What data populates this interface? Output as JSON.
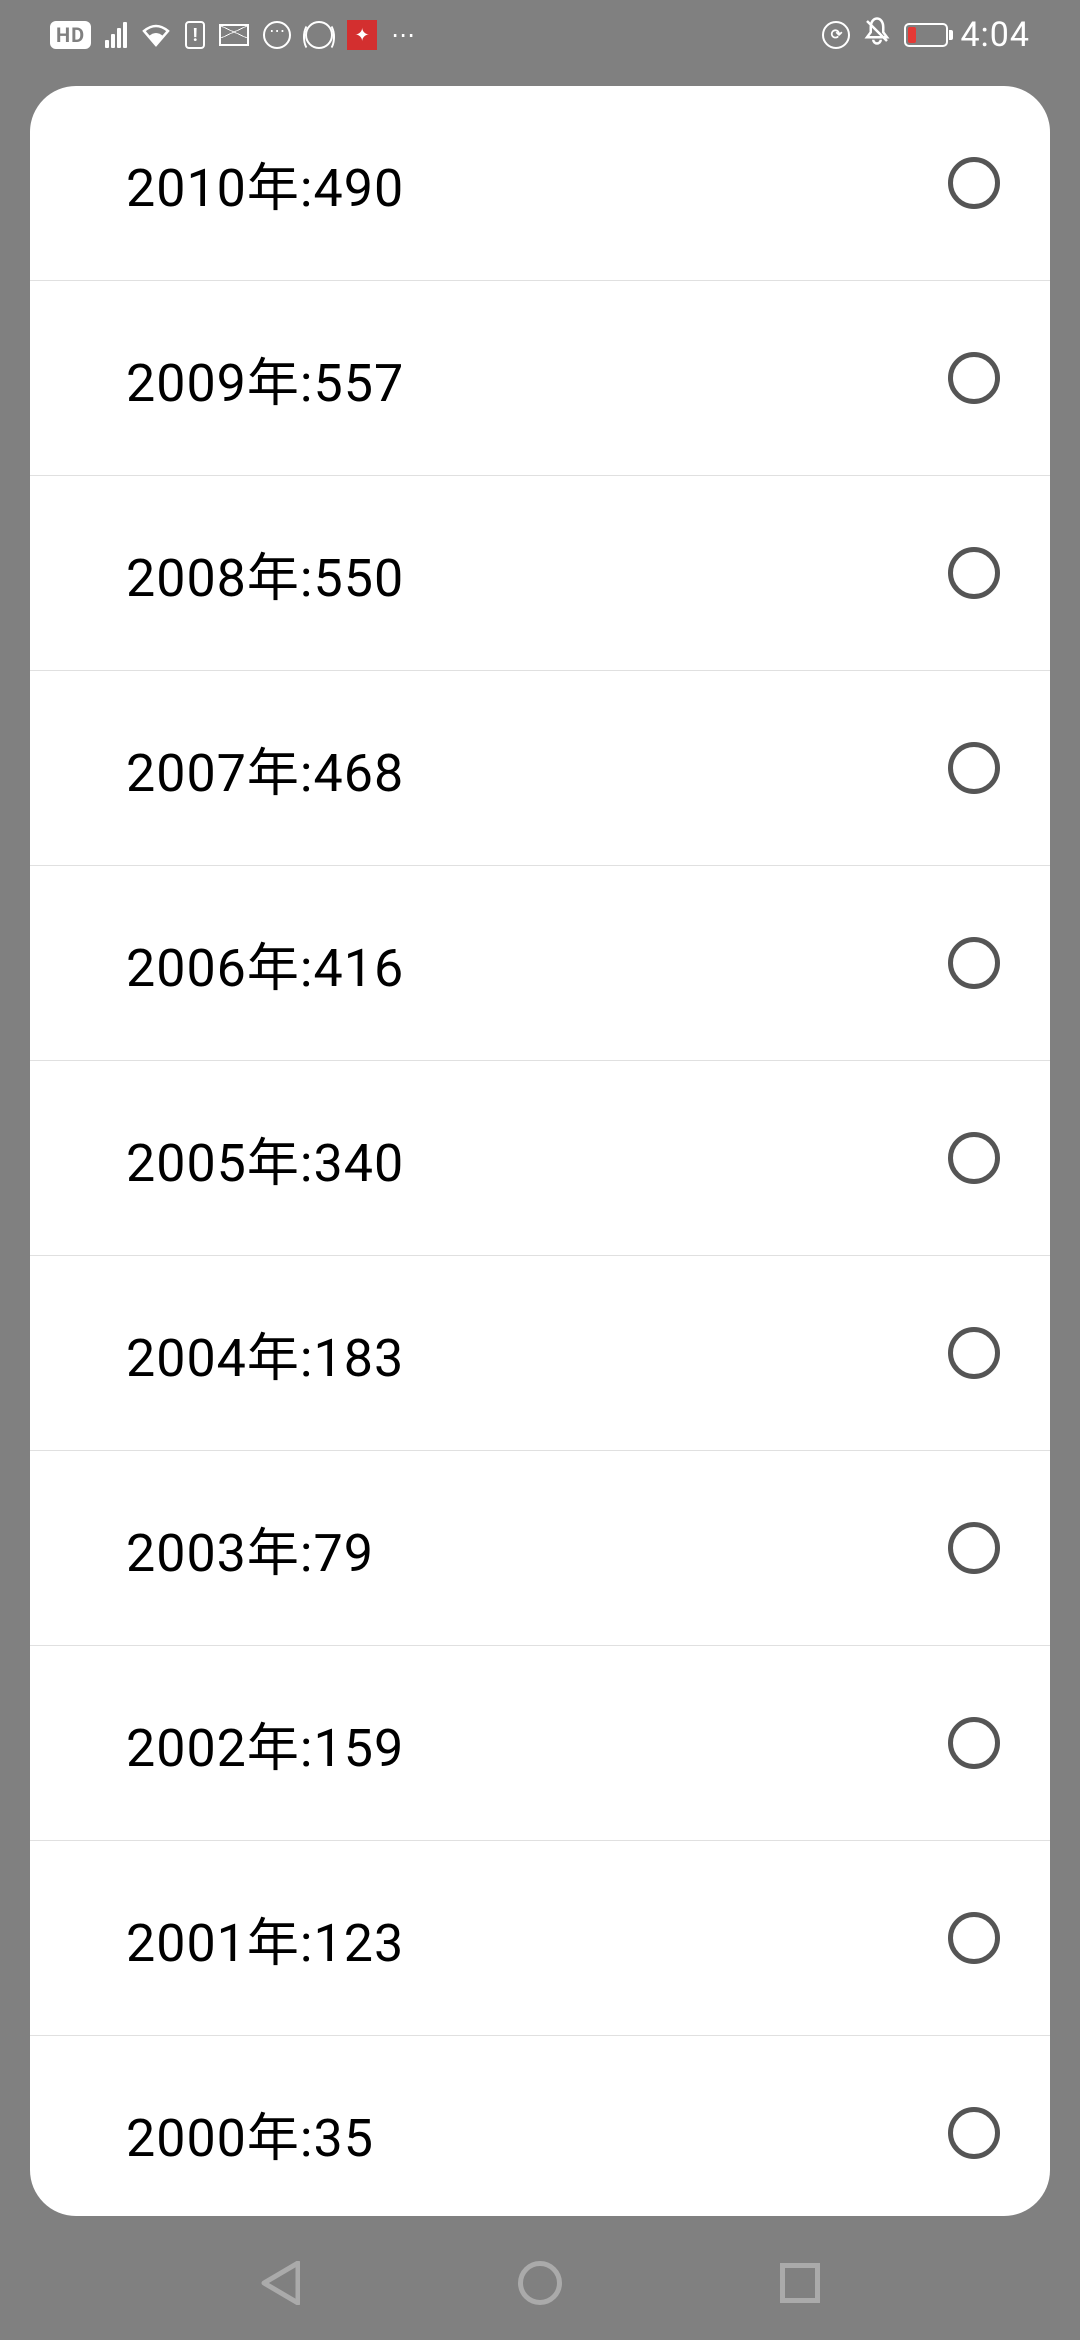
{
  "status": {
    "hd_label": "HD",
    "circ_label": "⏱",
    "clock": "4:04"
  },
  "options": [
    {
      "label": "2010年:490",
      "year": 2010,
      "value": 490
    },
    {
      "label": "2009年:557",
      "year": 2009,
      "value": 557
    },
    {
      "label": "2008年:550",
      "year": 2008,
      "value": 550
    },
    {
      "label": "2007年:468",
      "year": 2007,
      "value": 468
    },
    {
      "label": "2006年:416",
      "year": 2006,
      "value": 416
    },
    {
      "label": "2005年:340",
      "year": 2005,
      "value": 340
    },
    {
      "label": "2004年:183",
      "year": 2004,
      "value": 183
    },
    {
      "label": "2003年:79",
      "year": 2003,
      "value": 79
    },
    {
      "label": "2002年:159",
      "year": 2002,
      "value": 159
    },
    {
      "label": "2001年:123",
      "year": 2001,
      "value": 123
    },
    {
      "label": "2000年:35",
      "year": 2000,
      "value": 35
    }
  ]
}
